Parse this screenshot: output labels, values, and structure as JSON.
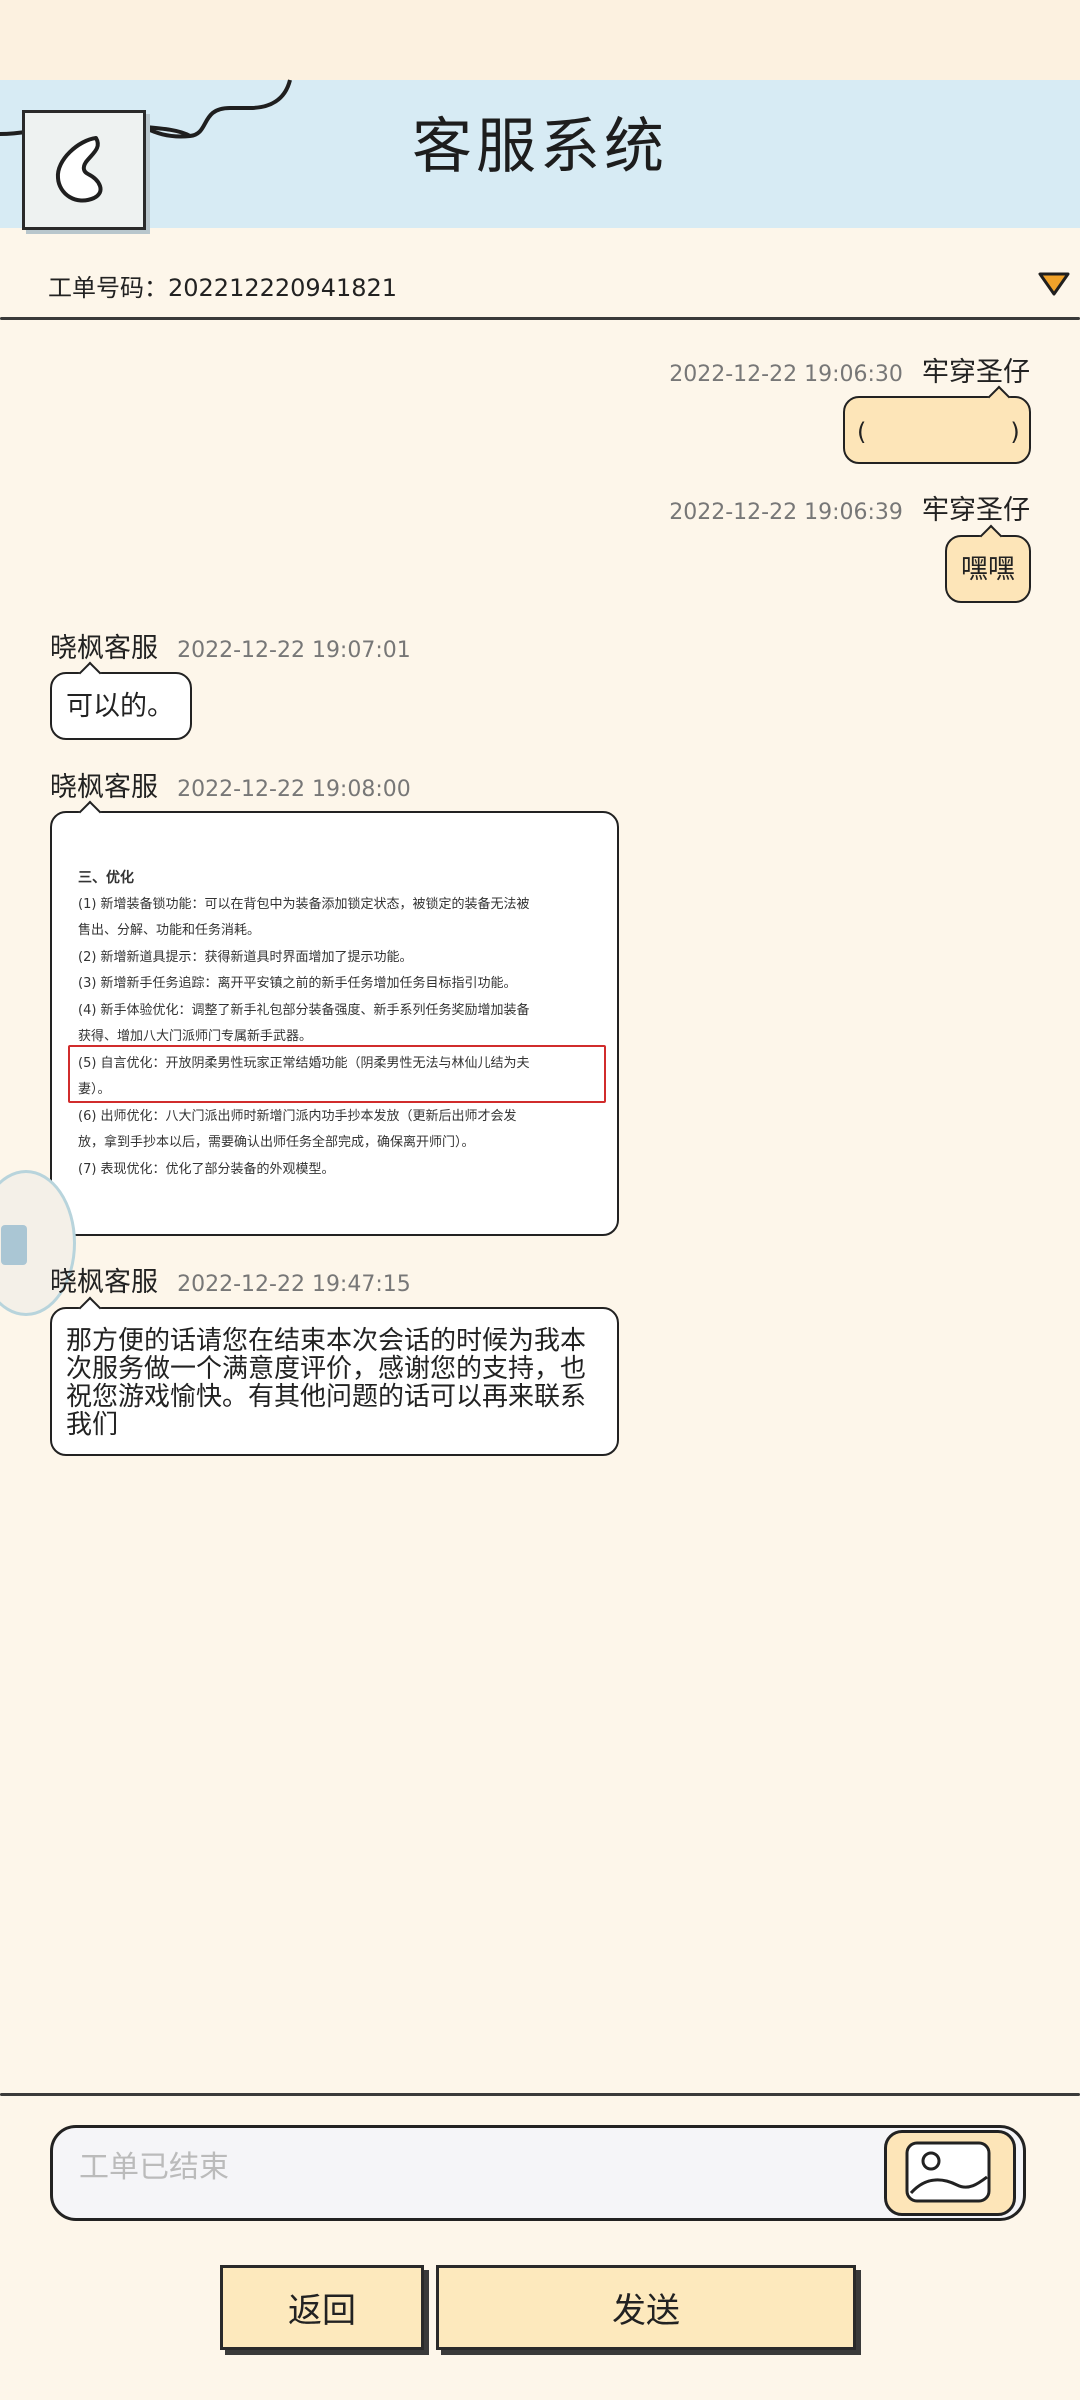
{
  "header": {
    "title": "客服系统"
  },
  "ticket": {
    "label": "工单号码：",
    "number": "202212220941821"
  },
  "messages": [
    {
      "side": "mine",
      "name": "牢穿圣仔",
      "time": "2022-12-22 19:06:30",
      "text": "(　　　　　　)"
    },
    {
      "side": "mine",
      "name": "牢穿圣仔",
      "time": "2022-12-22 19:06:39",
      "text": "嘿嘿"
    },
    {
      "side": "theirs",
      "name": "晓枫客服",
      "time": "2022-12-22 19:07:01",
      "text": "可以的。"
    },
    {
      "side": "theirs",
      "name": "晓枫客服",
      "time": "2022-12-22 19:08:00",
      "text": ""
    },
    {
      "side": "theirs",
      "name": "晓枫客服",
      "time": "2022-12-22 19:47:15",
      "text": "那方便的话请您在结束本次会话的时候为我本次服务做一个满意度评价，感谢您的支持，也祝您游戏愉快。有其他问题的话可以再来联系我们"
    }
  ],
  "image_doc": {
    "heading": "三、优化",
    "lines": [
      "(1) 新增装备锁功能：可以在背包中为装备添加锁定状态，被锁定的装备无法被",
      "售出、分解、功能和任务消耗。",
      "(2) 新增新道具提示：获得新道具时界面增加了提示功能。",
      "(3) 新增新手任务追踪：离开平安镇之前的新手任务增加任务目标指引功能。",
      "(4) 新手体验优化：调整了新手礼包部分装备强度、新手系列任务奖励增加装备",
      "获得、增加八大门派师门专属新手武器。",
      "(5) 自言优化：开放阴柔男性玩家正常结婚功能（阴柔男性无法与林仙儿结为夫",
      "妻）。",
      "(6) 出师优化：八大门派出师时新增门派内功手抄本发放（更新后出师才会发",
      "放，拿到手抄本以后，需要确认出师任务全部完成，确保离开师门）。",
      "(7) 表现优化：优化了部分装备的外观模型。"
    ]
  },
  "input": {
    "placeholder": "工单已结束"
  },
  "buttons": {
    "back": "返回",
    "send": "发送"
  },
  "colors": {
    "header_bg": "#d7ebf4",
    "page_bg": "#fdf6ea",
    "bubble_mine": "#fde5b8",
    "highlight": "#d12c2c"
  }
}
